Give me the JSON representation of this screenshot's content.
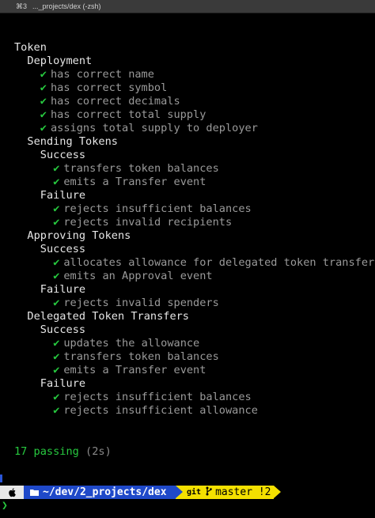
{
  "window": {
    "shortcut": "⌘3",
    "title": "..._projects/dex (-zsh)"
  },
  "output": {
    "root": "Token",
    "suites": [
      {
        "name": "Deployment",
        "tests": [
          "has correct name",
          "has correct symbol",
          "has correct decimals",
          "has correct total supply",
          "assigns total supply to deployer"
        ]
      },
      {
        "name": "Sending Tokens",
        "groups": [
          {
            "name": "Success",
            "tests": [
              "transfers token balances",
              "emits a Transfer event"
            ]
          },
          {
            "name": "Failure",
            "tests": [
              "rejects insufficient balances",
              "rejects invalid recipients"
            ]
          }
        ]
      },
      {
        "name": "Approving Tokens",
        "groups": [
          {
            "name": "Success",
            "tests": [
              "allocates allowance for delegated token transfer",
              "emits an Approval event"
            ]
          },
          {
            "name": "Failure",
            "tests": [
              "rejects invalid spenders"
            ]
          }
        ]
      },
      {
        "name": "Delegated Token Transfers",
        "groups": [
          {
            "name": "Success",
            "tests": [
              "updates the allowance",
              "transfers token balances",
              "emits a Transfer event"
            ]
          },
          {
            "name": "Failure",
            "tests": [
              "rejects insufficient balances",
              "rejects insufficient allowance"
            ]
          }
        ]
      }
    ],
    "summary": {
      "passing": "17 passing",
      "duration": "(2s)"
    },
    "check_glyph": "✔"
  },
  "prompt": {
    "apple_icon": "apple-icon",
    "folder_icon": "folder-icon",
    "path": "~/dev/2_projects/dex",
    "git_label": "git",
    "branch_icon": "branch-icon",
    "branch": "master !2",
    "cursor": "❯"
  },
  "colors": {
    "background": "#000000",
    "text": "#e6e6e6",
    "dim_text": "#9a9a9a",
    "check": "#27c93f",
    "dir_segment": "#1f49c9",
    "git_segment": "#f4e000"
  }
}
